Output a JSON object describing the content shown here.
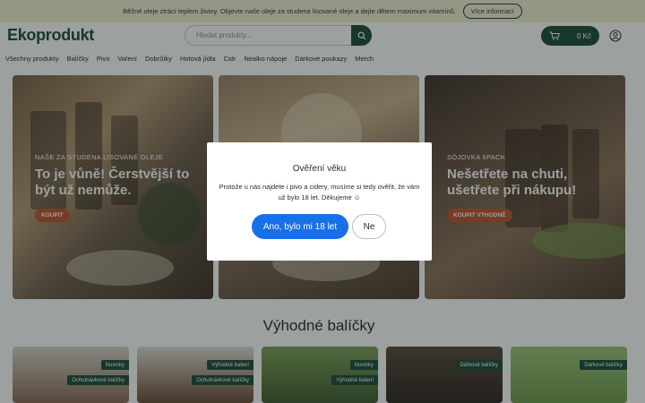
{
  "promo": {
    "text": "Běžné oleje ztrácí teplem živiny. Objevte naše oleje za studena lisované oleje a dejte dětem maximum vitamínů.",
    "button": "Více informací"
  },
  "header": {
    "logo": "Ekoprodukt",
    "search_placeholder": "Hledat produkty...",
    "cart_total": "0 Kč"
  },
  "nav": {
    "items": [
      "Všechny produkty",
      "Balíčky",
      "Pivo",
      "Vaření",
      "Dobrůtky",
      "Hotová jídla",
      "Cidr",
      "Nealko nápoje",
      "Dárkové poukazy",
      "Merch"
    ]
  },
  "heroes": [
    {
      "label": "NAŠE ZA STUDENA LISOVANÉ OLEJE",
      "title": "To je vůně! Čerstvější to být už nemůže.",
      "button": "KOUPIT"
    },
    {
      "label": "",
      "title": "",
      "button": ""
    },
    {
      "label": "SÓJOVKA 6PACK",
      "title": "Nešetřete na chuti, ušetřete při nákupu!",
      "button": "KOUPIT VÝHODNĚ"
    }
  ],
  "modal": {
    "title": "Ověření věku",
    "text": "Protože u nás najdete i pivo a cidery, musíme si tedy ověřit, že vám už bylo 18 let. Děkujeme ☺",
    "yes": "Ano, bylo mi 18 let",
    "no": "Ne"
  },
  "section": {
    "title": "Výhodné balíčky"
  },
  "cards": [
    {
      "badges": [
        "Novinky",
        "Ochutnávkové balíčky"
      ]
    },
    {
      "badges": [
        "Výhodné balení",
        "Ochutnávkové balíčky"
      ]
    },
    {
      "badges": [
        "Novinky",
        "Výhodné balení"
      ]
    },
    {
      "badges": [
        "Dárkové balíčky"
      ]
    },
    {
      "badges": [
        "Dárkové balíčky"
      ]
    }
  ],
  "colors": {
    "brand": "#1c4a38",
    "promo_bg": "#f3f0d2",
    "accent": "#c0542e",
    "confirm": "#1870e8"
  }
}
